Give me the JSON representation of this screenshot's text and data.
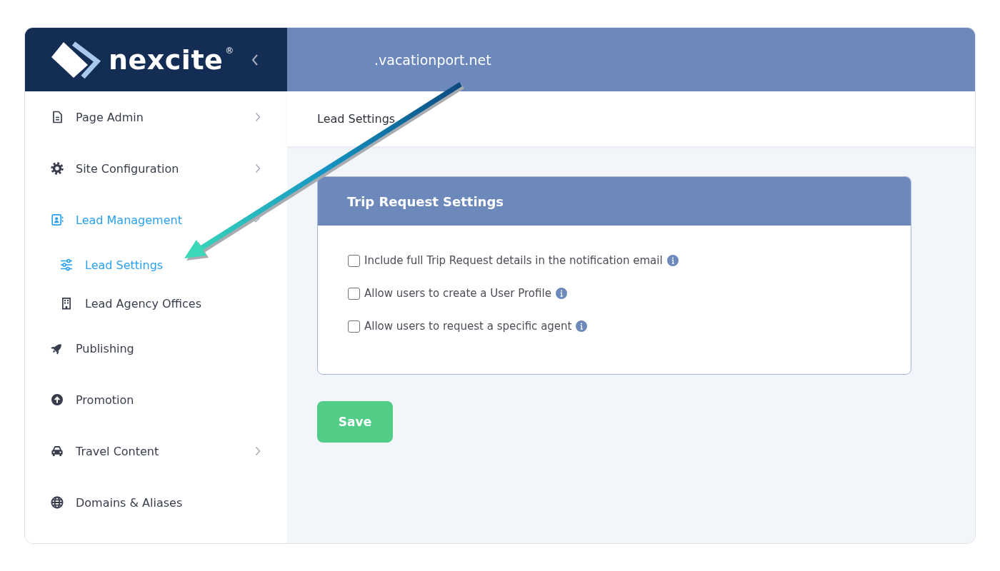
{
  "sidebar": {
    "logo": "nexcite$^{®}$",
    "items": [
      {
        "label": "Page Admin",
        "expanded": false,
        "selected": false
      },
      {
        "label": "Site Configuration",
        "expanded": false,
        "selected": false
      },
      {
        "label": "Lead Management",
        "expanded": true,
        "selected": true,
        "children": [
          {
            "label": "Lead Settings",
            "selected": true
          },
          {
            "label": "Lead Agency Offices",
            "selected": false
          }
        ]
      },
      {
        "label": "Publishing",
        "selected": false
      },
      {
        "label": "Promotion",
        "selected": false
      },
      {
        "label": "Travel Content",
        "expanded": false,
        "selected": false
      },
      {
        "label": "Domains & Aliases",
        "selected": false
      }
    ]
  },
  "top_bar": {
    "domain": ".vacationport.net"
  },
  "page": {
    "title": "Lead Settings"
  },
  "panel": {
    "title": "Trip Request Settings",
    "options": [
      {
        "label": "Include full Trip Request details in the notification email",
        "checked": false,
        "info": true
      },
      {
        "label": "Allow users to create a User Profile",
        "checked": false,
        "info": true
      },
      {
        "label": "Allow users to request a specific agent",
        "checked": false,
        "info": true
      }
    ]
  },
  "save_button": {
    "label": "Save"
  }
}
